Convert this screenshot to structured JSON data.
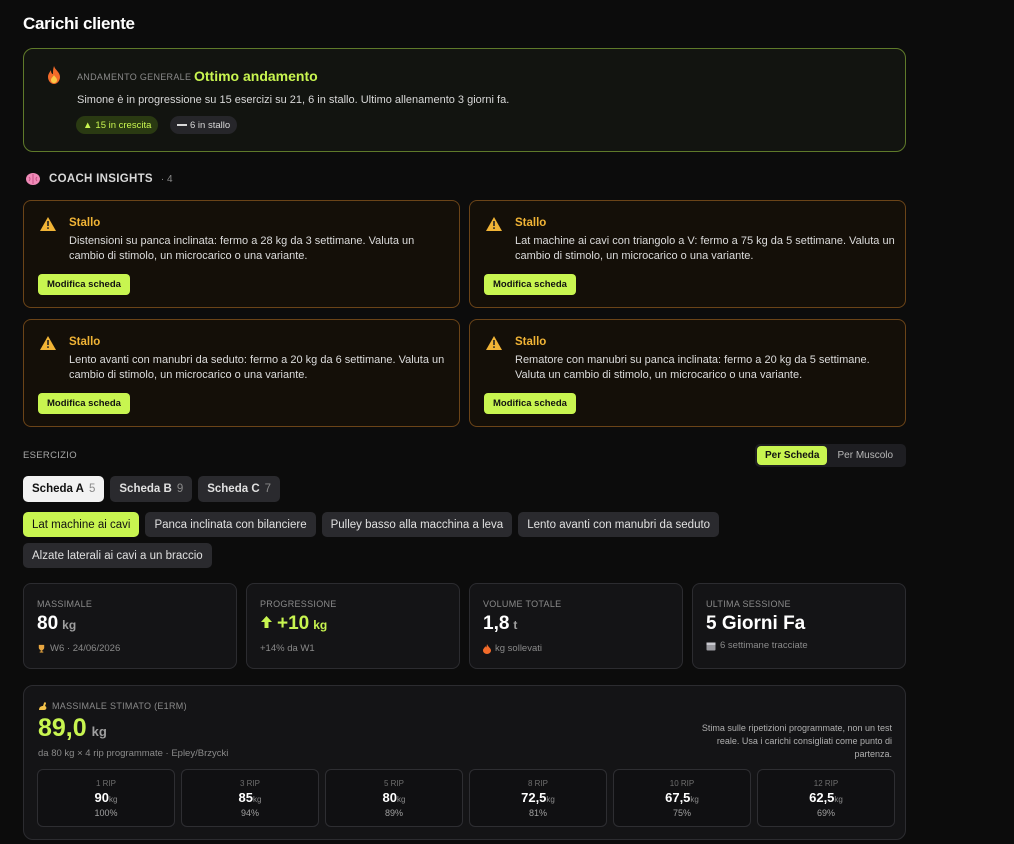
{
  "page": {
    "title": "Carichi cliente"
  },
  "overview": {
    "kicker": "ANDAMENTO GENERALE",
    "status": "Ottimo andamento",
    "description": "Simone è in progressione su 15 esercizi su 21, 6 in stallo. Ultimo allenamento 3 giorni fa.",
    "growing_pill": "15 in crescita",
    "stalled_pill": "6 in stallo"
  },
  "insights": {
    "label": "COACH INSIGHTS",
    "count": "· 4",
    "items": [
      {
        "title": "Stallo",
        "text": "Distensioni su panca inclinata: fermo a 28 kg da 3 settimane. Valuta un cambio di stimolo, un microcarico o una variante.",
        "button": "Modifica scheda"
      },
      {
        "title": "Stallo",
        "text": "Lat machine ai cavi con triangolo a V: fermo a 75 kg da 5 settimane. Valuta un cambio di stimolo, un microcarico o una variante.",
        "button": "Modifica scheda"
      },
      {
        "title": "Stallo",
        "text": "Lento avanti con manubri da seduto: fermo a 20 kg da 6 settimane. Valuta un cambio di stimolo, un microcarico o una variante.",
        "button": "Modifica scheda"
      },
      {
        "title": "Stallo",
        "text": "Rematore con manubri su panca inclinata: fermo a 20 kg da 5 settimane. Valuta un cambio di stimolo, un microcarico o una variante.",
        "button": "Modifica scheda"
      }
    ]
  },
  "exercise": {
    "label": "ESERCIZIO",
    "view_options": [
      "Per Scheda",
      "Per Muscolo"
    ],
    "tabs": [
      {
        "label": "Scheda A",
        "count": "5"
      },
      {
        "label": "Scheda B",
        "count": "9"
      },
      {
        "label": "Scheda C",
        "count": "7"
      }
    ],
    "chips": [
      "Lat machine ai cavi",
      "Panca inclinata con bilanciere",
      "Pulley basso alla macchina a leva",
      "Lento avanti con manubri da seduto",
      "Alzate laterali ai cavi a un braccio"
    ]
  },
  "stats": [
    {
      "key": "MASSIMALE",
      "value": "80",
      "unit": "kg",
      "sub": "W6 · 24/06/2026",
      "icon": "trophy-icon"
    },
    {
      "key": "PROGRESSIONE",
      "value": "+10",
      "unit": "kg",
      "sub": "+14% da W1",
      "icon": "arrow-up-icon"
    },
    {
      "key": "VOLUME TOTALE",
      "value": "1,8",
      "unit": "t",
      "sub": "kg sollevati",
      "icon": "fire-icon"
    },
    {
      "key": "ULTIMA SESSIONE",
      "value": "5 Giorni Fa",
      "unit": "",
      "sub": "6 settimane tracciate",
      "icon": "calendar-icon"
    }
  ],
  "e1rm": {
    "key": "MASSIMALE STIMATO (E1RM)",
    "value": "89,0",
    "unit": "kg",
    "footnote": "da 80 kg × 4 rip programmate · Epley/Brzycki",
    "note": "Stima sulle ripetizioni programmate, non un test reale. Usa i carichi consigliati come punto di partenza.",
    "reps": [
      {
        "label": "1 RIP",
        "value": "90",
        "unit": "kg",
        "pct": "100%"
      },
      {
        "label": "3 RIP",
        "value": "85",
        "unit": "kg",
        "pct": "94%"
      },
      {
        "label": "5 RIP",
        "value": "80",
        "unit": "kg",
        "pct": "89%"
      },
      {
        "label": "8 RIP",
        "value": "72,5",
        "unit": "kg",
        "pct": "81%"
      },
      {
        "label": "10 RIP",
        "value": "67,5",
        "unit": "kg",
        "pct": "75%"
      },
      {
        "label": "12 RIP",
        "value": "62,5",
        "unit": "kg",
        "pct": "69%"
      }
    ]
  },
  "colors": {
    "accent": "#c8f550",
    "warning": "#f1b436",
    "background": "#0c0c0c"
  }
}
